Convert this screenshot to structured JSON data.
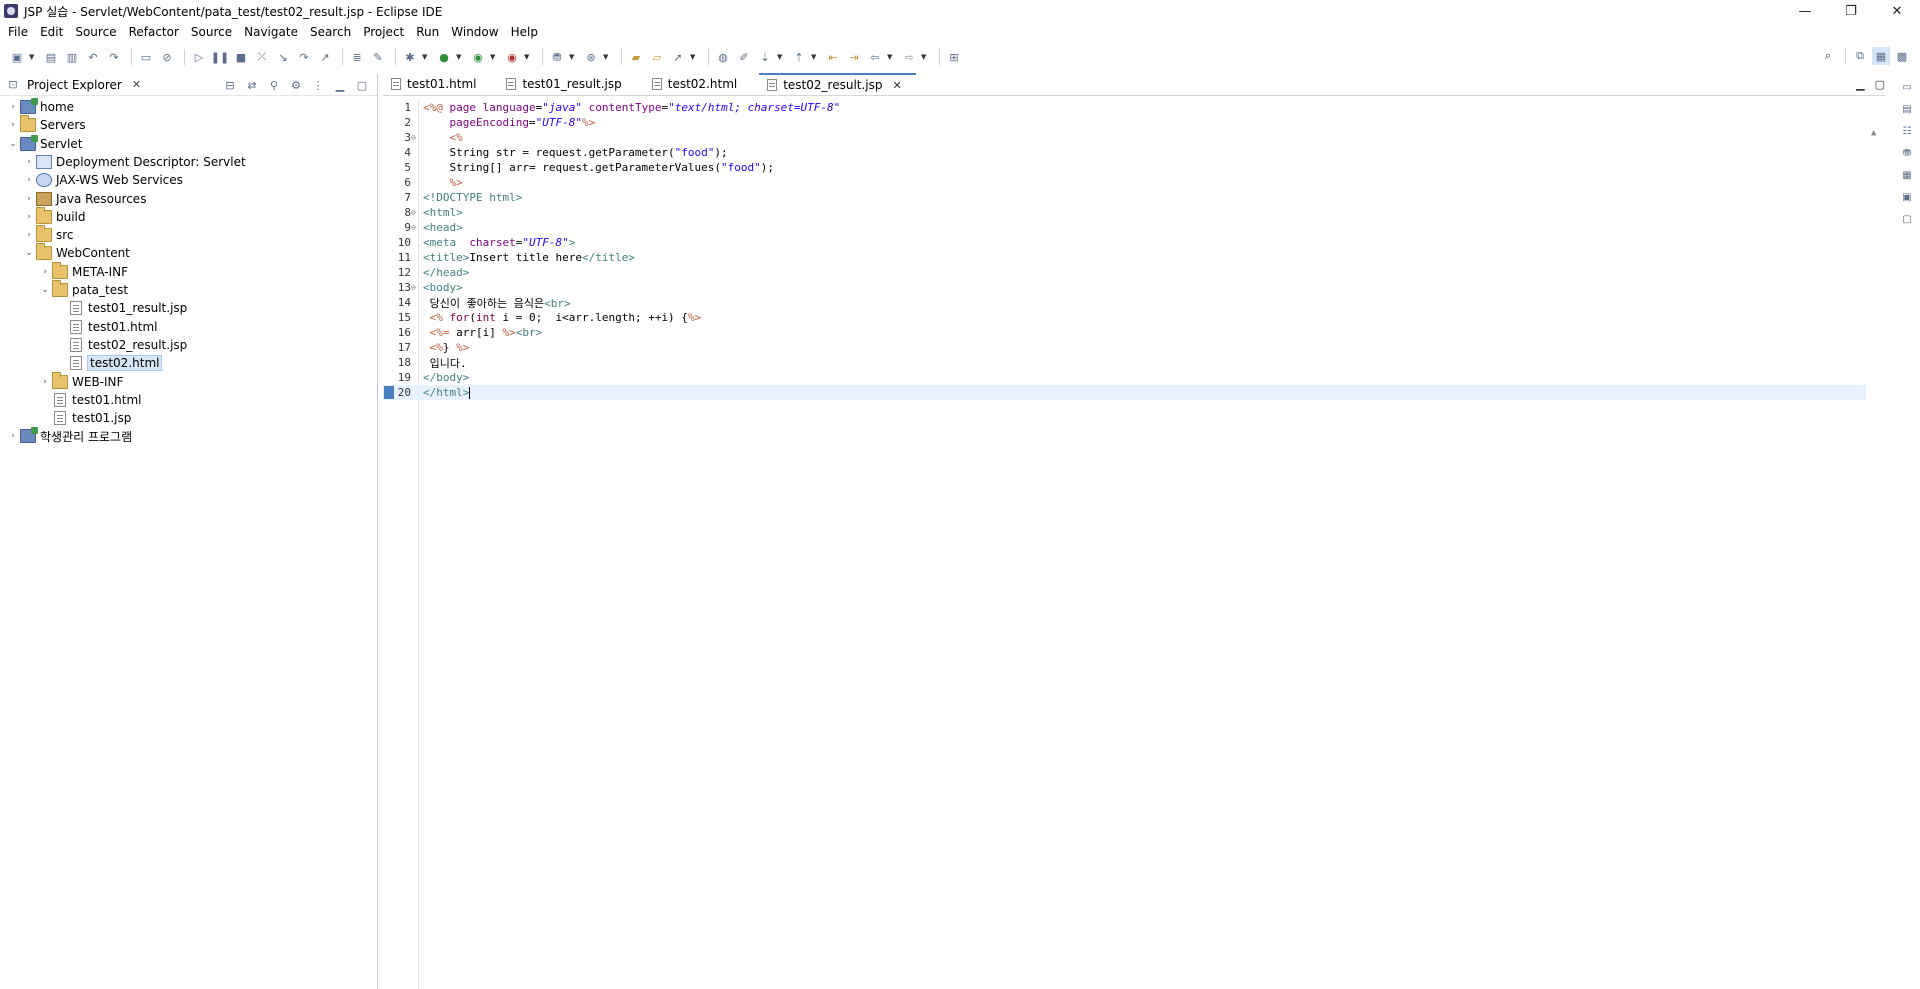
{
  "window": {
    "title": "JSP 실습 - Servlet/WebContent/pata_test/test02_result.jsp - Eclipse IDE",
    "minimize_label": "—",
    "maximize_label": "❐",
    "close_label": "✕"
  },
  "menu": {
    "items": [
      "File",
      "Edit",
      "Source",
      "Refactor",
      "Source",
      "Navigate",
      "Search",
      "Project",
      "Run",
      "Window",
      "Help"
    ]
  },
  "explorer": {
    "tab_label": "Project Explorer",
    "tree": [
      {
        "label": "home",
        "icon": "project-icon",
        "arrow": "›",
        "depth": 0
      },
      {
        "label": "Servers",
        "icon": "folder-icon",
        "arrow": "›",
        "depth": 0
      },
      {
        "label": "Servlet",
        "icon": "project-icon",
        "arrow": "⌄",
        "depth": 0
      },
      {
        "label": "Deployment Descriptor: Servlet",
        "icon": "descriptor-icon",
        "arrow": "›",
        "depth": 1
      },
      {
        "label": "JAX-WS Web Services",
        "icon": "web-services-icon",
        "arrow": "›",
        "depth": 1
      },
      {
        "label": "Java Resources",
        "icon": "java-resources-icon",
        "arrow": "›",
        "depth": 1
      },
      {
        "label": "build",
        "icon": "folder-icon",
        "arrow": "›",
        "depth": 1
      },
      {
        "label": "src",
        "icon": "folder-icon",
        "arrow": "›",
        "depth": 1
      },
      {
        "label": "WebContent",
        "icon": "folder-icon",
        "arrow": "⌄",
        "depth": 1
      },
      {
        "label": "META-INF",
        "icon": "folder-icon",
        "arrow": "›",
        "depth": 2
      },
      {
        "label": "pata_test",
        "icon": "folder-icon",
        "arrow": "⌄",
        "depth": 2
      },
      {
        "label": "test01_result.jsp",
        "icon": "file-icon",
        "arrow": "",
        "depth": 3
      },
      {
        "label": "test01.html",
        "icon": "file-icon",
        "arrow": "",
        "depth": 3
      },
      {
        "label": "test02_result.jsp",
        "icon": "file-icon",
        "arrow": "",
        "depth": 3
      },
      {
        "label": "test02.html",
        "icon": "file-icon",
        "arrow": "",
        "depth": 3,
        "selected": true
      },
      {
        "label": "WEB-INF",
        "icon": "folder-icon",
        "arrow": "›",
        "depth": 2
      },
      {
        "label": "test01.html",
        "icon": "file-icon",
        "arrow": "",
        "depth": 2
      },
      {
        "label": "test01.jsp",
        "icon": "file-icon",
        "arrow": "",
        "depth": 2
      },
      {
        "label": "학생관리 프로그램",
        "icon": "project-icon",
        "arrow": "›",
        "depth": 0
      }
    ]
  },
  "editor": {
    "tabs": [
      {
        "label": "test01.html",
        "active": false
      },
      {
        "label": "test01_result.jsp",
        "active": false
      },
      {
        "label": "test02.html",
        "active": false
      },
      {
        "label": "test02_result.jsp",
        "active": true
      }
    ],
    "lines": [
      {
        "n": "1",
        "fold": "",
        "html": "<span class='t-jsp'>&lt;%@</span> <span class='t-attr'>page</span> <span class='t-attr'>language</span>=<span class='t-str'>\"java\"</span> <span class='t-attr'>contentType</span>=<span class='t-str'>\"text/html; charset=UTF-8\"</span>"
      },
      {
        "n": "2",
        "fold": "",
        "html": "    <span class='t-attr'>pageEncoding</span>=<span class='t-str'>\"UTF-8\"</span><span class='t-jsp'>%&gt;</span>"
      },
      {
        "n": "3",
        "fold": "⊖",
        "html": "    <span class='t-jsp'>&lt;%</span>"
      },
      {
        "n": "4",
        "fold": "",
        "html": "    String str = request.getParameter(<span class='t-jstr'>\"food\"</span>);"
      },
      {
        "n": "5",
        "fold": "",
        "html": "    String[] arr= request.getParameterValues(<span class='t-jstr'>\"food\"</span>);"
      },
      {
        "n": "6",
        "fold": "",
        "html": "    <span class='t-jsp'>%&gt;</span>"
      },
      {
        "n": "7",
        "fold": "",
        "html": "<span class='t-tag'>&lt;!DOCTYPE html&gt;</span>"
      },
      {
        "n": "8",
        "fold": "⊖",
        "html": "<span class='t-tag'>&lt;html&gt;</span>"
      },
      {
        "n": "9",
        "fold": "⊖",
        "html": "<span class='t-tag'>&lt;head&gt;</span>"
      },
      {
        "n": "10",
        "fold": "",
        "html": "<span class='t-tag'>&lt;meta</span>  <span class='t-attr'>charset</span>=<span class='t-str'>\"UTF-8\"</span><span class='t-tag'>&gt;</span>"
      },
      {
        "n": "11",
        "fold": "",
        "html": "<span class='t-tag'>&lt;title&gt;</span>Insert title here<span class='t-tag'>&lt;/title&gt;</span>"
      },
      {
        "n": "12",
        "fold": "",
        "html": "<span class='t-tag'>&lt;/head&gt;</span>"
      },
      {
        "n": "13",
        "fold": "⊖",
        "html": "<span class='t-tag'>&lt;body&gt;</span>"
      },
      {
        "n": "14",
        "fold": "",
        "html": " 당신이 좋아하는 음식은<span class='t-tag'>&lt;br&gt;</span>"
      },
      {
        "n": "15",
        "fold": "",
        "html": " <span class='t-jsp'>&lt;%</span> <span class='t-kw'>for</span>(<span class='t-kw'>int</span> i = 0;  i&lt;arr.length; ++i) {<span class='t-jsp'>%&gt;</span>"
      },
      {
        "n": "16",
        "fold": "",
        "html": " <span class='t-jsp'>&lt;%=</span> arr[i] <span class='t-jsp'>%&gt;</span><span class='t-tag'>&lt;br&gt;</span>"
      },
      {
        "n": "17",
        "fold": "",
        "html": " <span class='t-jsp'>&lt;%</span>} <span class='t-jsp'>%&gt;</span>"
      },
      {
        "n": "18",
        "fold": "",
        "html": " 입니다."
      },
      {
        "n": "19",
        "fold": "",
        "html": "<span class='t-tag'>&lt;/body&gt;</span>"
      },
      {
        "n": "20",
        "fold": "",
        "html": "<span class='t-tag'>&lt;/html&gt;</span><span class='caret'></span>",
        "current": true
      }
    ]
  }
}
